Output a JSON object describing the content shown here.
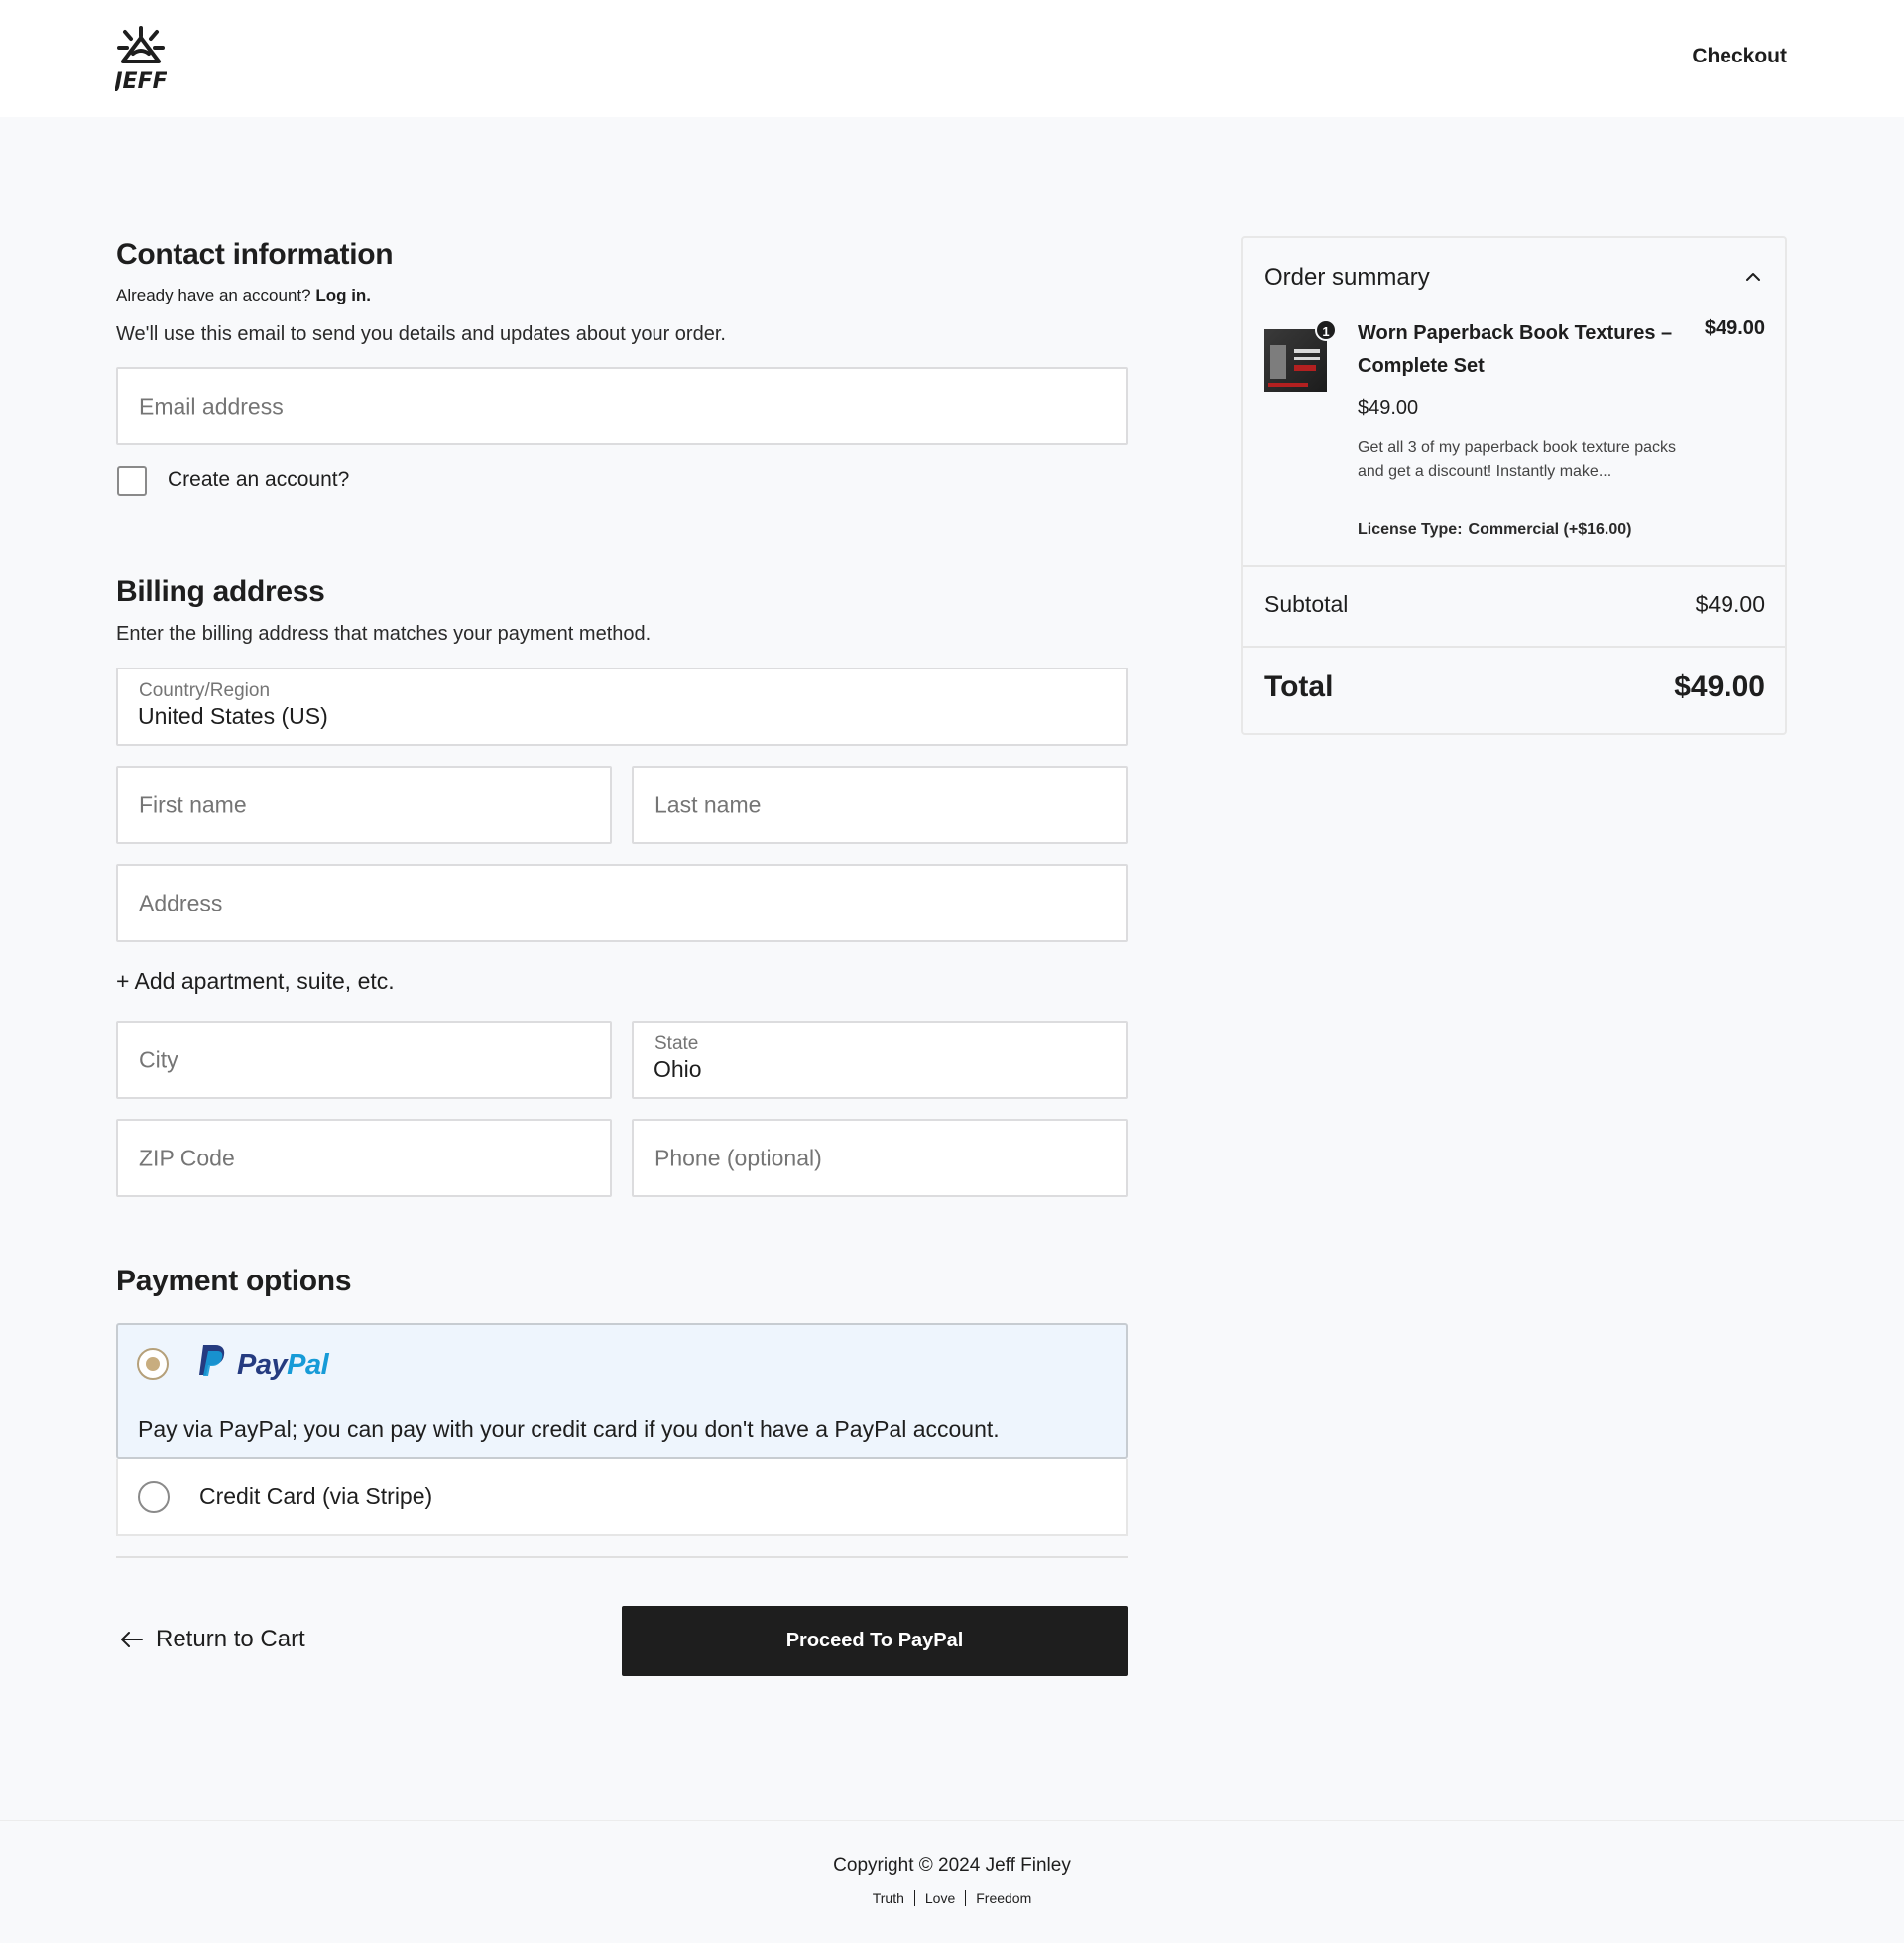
{
  "header": {
    "logo_text": "JEFF",
    "checkout_link": "Checkout"
  },
  "contact": {
    "title": "Contact information",
    "have_account": "Already have an account?",
    "login_link": "Log in.",
    "description": "We'll use this email to send you details and updates about your order.",
    "email_placeholder": "Email address",
    "create_account_label": "Create an account?"
  },
  "billing": {
    "title": "Billing address",
    "description": "Enter the billing address that matches your payment method.",
    "country_label": "Country/Region",
    "country_value": "United States (US)",
    "first_name_placeholder": "First name",
    "last_name_placeholder": "Last name",
    "address_placeholder": "Address",
    "add_apartment": "+ Add apartment, suite, etc.",
    "city_placeholder": "City",
    "state_label": "State",
    "state_value": "Ohio",
    "zip_placeholder": "ZIP Code",
    "phone_placeholder": "Phone (optional)"
  },
  "payment": {
    "title": "Payment options",
    "paypal_word_1": "Pay",
    "paypal_word_2": "Pal",
    "paypal_description": "Pay via PayPal; you can pay with your credit card if you don't have a PayPal account.",
    "stripe_label": "Credit Card (via Stripe)",
    "selected": "paypal"
  },
  "actions": {
    "return_label": "Return to Cart",
    "proceed_label": "Proceed To PayPal"
  },
  "summary": {
    "title": "Order summary",
    "item": {
      "quantity": "1",
      "name": "Worn Paperback Book Textures – Complete Set",
      "line_total": "$49.00",
      "unit_price": "$49.00",
      "description": "Get all 3 of my paperback book texture packs and get a discount! Instantly make...",
      "license_label": "License Type:",
      "license_value": "Commercial (+$16.00)"
    },
    "subtotal_label": "Subtotal",
    "subtotal_value": "$49.00",
    "total_label": "Total",
    "total_value": "$49.00"
  },
  "footer": {
    "copyright": "Copyright © 2024 Jeff Finley",
    "links": [
      "Truth",
      "Love",
      "Freedom"
    ]
  },
  "colors": {
    "accent_dark": "#1e1e1e",
    "paypal_selected_bg": "#eef5fd",
    "radio_selected": "#c8ad7f",
    "paypal_blue_dark": "#253b80",
    "paypal_blue_light": "#179bd7"
  }
}
